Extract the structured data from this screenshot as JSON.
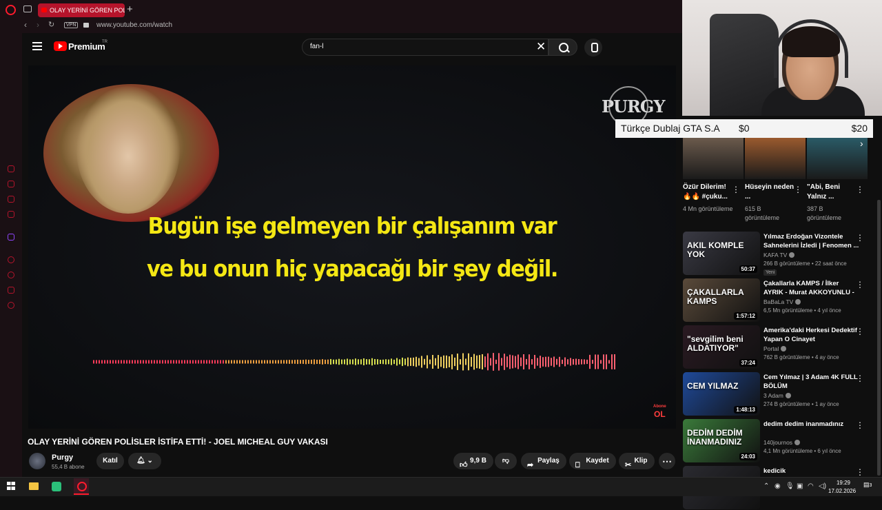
{
  "browser": {
    "tab_title": "OLAY YERİNİ GÖREN POLİ",
    "vpn_label": "VPN",
    "url": "www.youtube.com/watch"
  },
  "header": {
    "brand": "Premium",
    "country": "TR",
    "search_value": "fan-l"
  },
  "video": {
    "subtitle_line1": "Bugün işe gelmeyen bir çalışanım var",
    "subtitle_line2": "ve bu onun hiç yapacağı bir şey değil.",
    "watermark": "PURGY",
    "corner_top": "Abone",
    "corner_bottom": "OL",
    "title": "OLAY YERİNİ GÖREN POLİSLER İSTİFA ETTİ! - JOEL MICHEAL GUY VAKASI"
  },
  "channel": {
    "name": "Purgy",
    "subscribers": "55,4 B abone",
    "join_label": "Katıl"
  },
  "actions": {
    "likes": "9,9 B",
    "share": "Paylaş",
    "save": "Kaydet",
    "clip": "Klip"
  },
  "donation": {
    "title": "Türkçe Dublaj GTA S.A",
    "current": "$0",
    "goal": "$20"
  },
  "shorts": [
    {
      "title": "Özür Dilerim! 🔥🔥 #çuku...",
      "views": "4 Mn görüntüleme",
      "color": "#6b5a4c"
    },
    {
      "title": "Hüseyin neden ...",
      "views": "615 B görüntüleme",
      "color": "#9a5a2e"
    },
    {
      "title": "\"Abi, Beni Yalnız ...",
      "views": "387 B görüntüleme",
      "color": "#2a5a66"
    }
  ],
  "recommended": [
    {
      "title": "Yılmaz Erdoğan Vizontele Sahnelerini İzledi | Fenomen ...",
      "channel": "KAFA TV",
      "meta": "266 B görüntüleme • 22 saat önce",
      "badge": "Yeni",
      "duration": "50:37",
      "thumb_text": "AKIL KOMPLE YOK",
      "color": "#3a3a44"
    },
    {
      "title": "Çakallarla KAMPS / İlker AYRIK - Murat AKKOYUNLU - Timur ...",
      "channel": "BaBaLa TV",
      "meta": "6,5 Mn görüntüleme • 4 yıl önce",
      "badge": "",
      "duration": "1:57:12",
      "thumb_text": "ÇAKALLARLA KAMPS",
      "color": "#5a4a3a"
    },
    {
      "title": "Amerika'daki Herkesi Dedektif Yapan O Cinayet",
      "channel": "Portal",
      "meta": "762 B görüntüleme • 4 ay önce",
      "badge": "",
      "duration": "37:24",
      "thumb_text": "\"sevgilim beni ALDATIYOR\"",
      "color": "#2a1a22"
    },
    {
      "title": "Cem Yılmaz | 3 Adam 4K FULL BÖLÜM",
      "channel": "3 Adam",
      "meta": "274 B görüntüleme • 1 ay önce",
      "badge": "",
      "duration": "1:48:13",
      "thumb_text": "CEM YILMAZ",
      "color": "#1f4a9a"
    },
    {
      "title": "dedim dedim inanmadınız",
      "channel": "140journos",
      "meta": "4,1 Mn görüntüleme • 6 yıl önce",
      "badge": "",
      "duration": "24:03",
      "thumb_text": "DEDİM DEDİM İNANMADINIZ",
      "color": "#3a7a3a"
    },
    {
      "title": "kedicik",
      "channel": "",
      "meta": "",
      "badge": "",
      "duration": "",
      "thumb_text": "",
      "color": "#2a2a30"
    }
  ],
  "taskbar": {
    "time": "19:29",
    "date": "17.02.2026",
    "notifications": "3"
  }
}
